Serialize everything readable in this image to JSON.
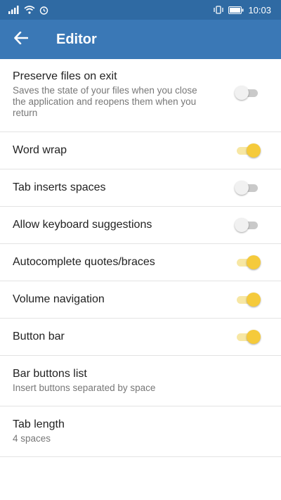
{
  "status_bar": {
    "time": "10:03",
    "left_icons": [
      "signal-icon",
      "wifi-icon",
      "alarm-icon"
    ],
    "right_icons": [
      "vibrate-icon",
      "battery-icon"
    ]
  },
  "app_bar": {
    "title": "Editor",
    "back_icon": "arrow-left-icon"
  },
  "colors": {
    "status_bar": "#2f6aa3",
    "app_bar": "#3a78b6",
    "toggle_on": "#f5ca3b",
    "toggle_off": "#f1f1f1"
  },
  "settings": {
    "preserve": {
      "label": "Preserve files on exit",
      "summary": "Saves the state of your files when you close the application and reopens them when you return",
      "enabled": false
    },
    "word_wrap": {
      "label": "Word wrap",
      "enabled": true
    },
    "tab_spaces": {
      "label": "Tab inserts spaces",
      "enabled": false
    },
    "keyboard_suggestions": {
      "label": "Allow keyboard suggestions",
      "enabled": false
    },
    "autocomplete": {
      "label": "Autocomplete quotes/braces",
      "enabled": true
    },
    "volume_nav": {
      "label": "Volume navigation",
      "enabled": true
    },
    "button_bar": {
      "label": "Button bar",
      "enabled": true
    },
    "bar_buttons_list": {
      "label": "Bar buttons list",
      "summary": "Insert buttons separated by space"
    },
    "tab_length": {
      "label": "Tab length",
      "summary": "4 spaces"
    }
  }
}
